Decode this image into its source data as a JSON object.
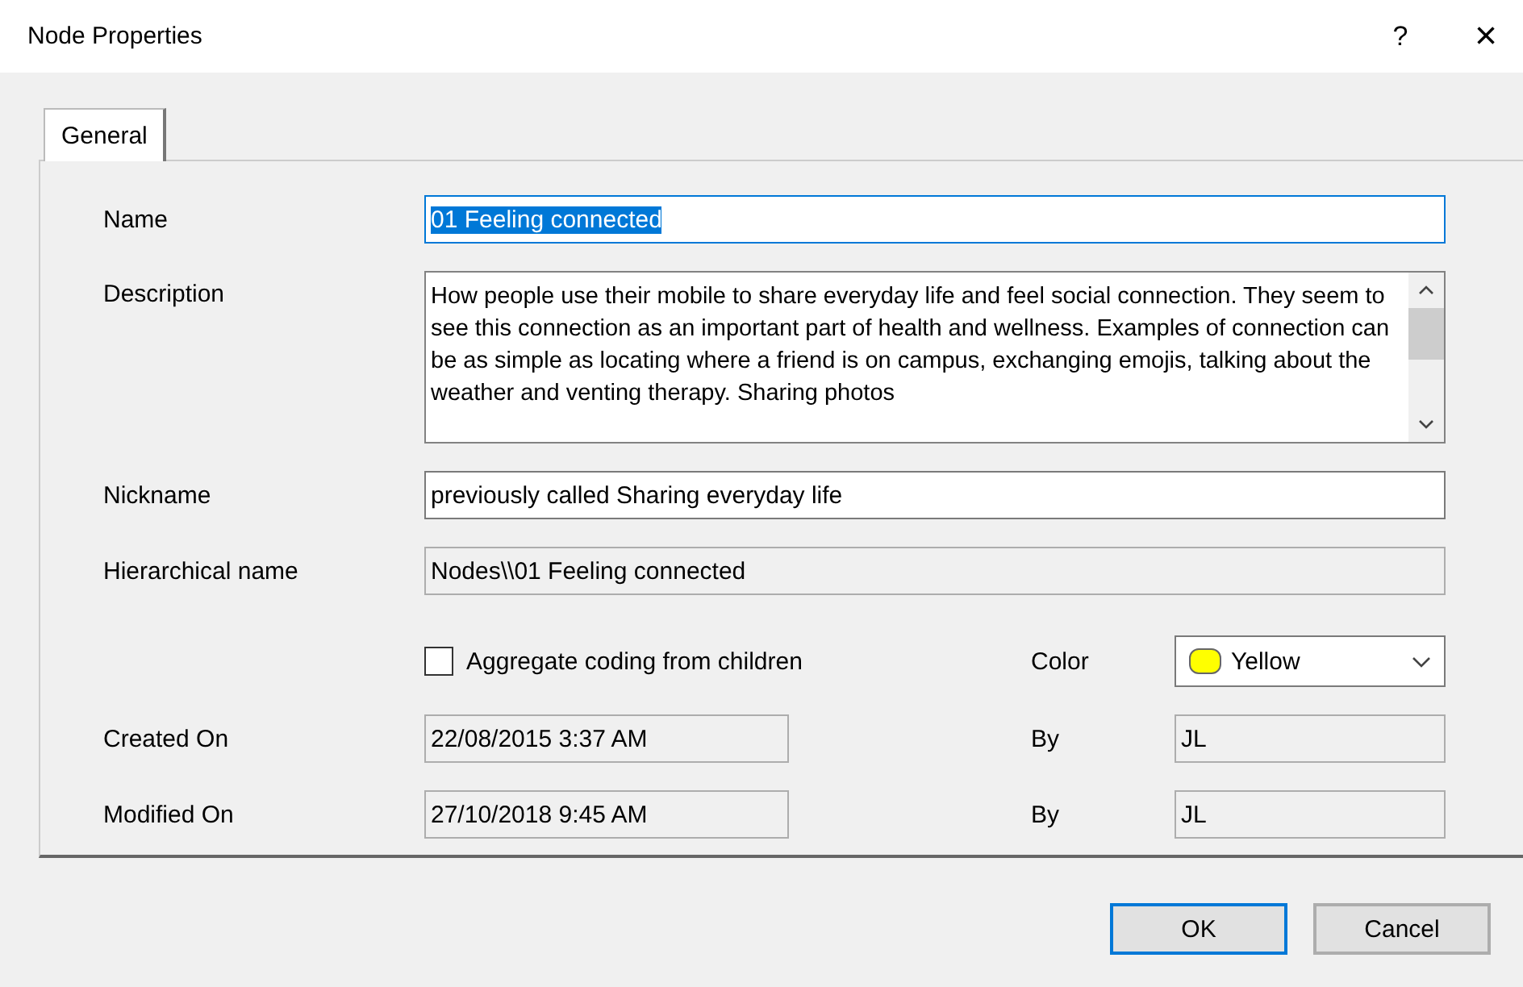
{
  "window": {
    "title": "Node Properties",
    "help": "?",
    "close": "×"
  },
  "tabs": [
    {
      "label": "General",
      "selected": true
    }
  ],
  "fields": [
    {
      "label": "Name",
      "value": "01 Feeling connected",
      "text_selected": true,
      "readonly": false,
      "focused": true
    },
    {
      "label": "Description",
      "value": "How people use their mobile to share everyday life and feel social connection. They seem to see this connection as an important part of health and wellness.  Examples of connection can be as simple as locating where a friend is on campus, exchanging emojis, talking about the weather and venting therapy.  Sharing photos",
      "kind": "multiline"
    },
    {
      "label": "Nickname",
      "value": "previously called Sharing everyday life",
      "text_selected": false,
      "readonly": false,
      "focused": false
    },
    {
      "label": "Hierarchical name",
      "value": "Nodes\\\\01 Feeling connected",
      "text_selected": false,
      "readonly": true,
      "focused": false
    }
  ],
  "aggregate": {
    "label": "Aggregate coding from children",
    "checked": false
  },
  "color": {
    "label": "Color",
    "value": "Yellow",
    "color": "#ffff00"
  },
  "dates": [
    {
      "label": "Created On",
      "value": "22/08/2015 3:37 AM",
      "by_label": "By",
      "by": "JL"
    },
    {
      "label": "Modified On",
      "value": "27/10/2018 9:45 AM",
      "by_label": "By",
      "by": "JL"
    }
  ],
  "buttons": [
    {
      "label": "OK",
      "default": true
    },
    {
      "label": "Cancel",
      "default": false
    }
  ]
}
